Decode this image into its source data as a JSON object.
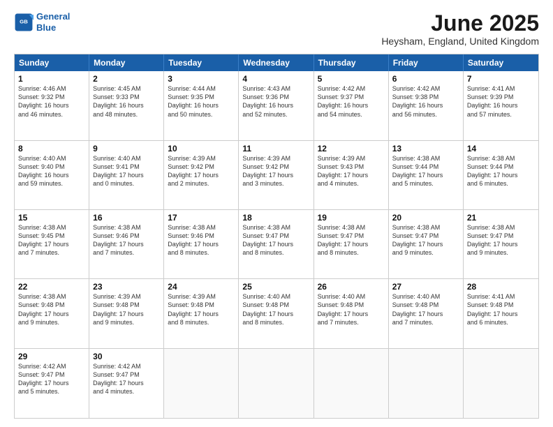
{
  "header": {
    "logo_line1": "General",
    "logo_line2": "Blue",
    "month_title": "June 2025",
    "location": "Heysham, England, United Kingdom"
  },
  "weekdays": [
    "Sunday",
    "Monday",
    "Tuesday",
    "Wednesday",
    "Thursday",
    "Friday",
    "Saturday"
  ],
  "rows": [
    [
      {
        "day": "1",
        "text": "Sunrise: 4:46 AM\nSunset: 9:32 PM\nDaylight: 16 hours\nand 46 minutes."
      },
      {
        "day": "2",
        "text": "Sunrise: 4:45 AM\nSunset: 9:33 PM\nDaylight: 16 hours\nand 48 minutes."
      },
      {
        "day": "3",
        "text": "Sunrise: 4:44 AM\nSunset: 9:35 PM\nDaylight: 16 hours\nand 50 minutes."
      },
      {
        "day": "4",
        "text": "Sunrise: 4:43 AM\nSunset: 9:36 PM\nDaylight: 16 hours\nand 52 minutes."
      },
      {
        "day": "5",
        "text": "Sunrise: 4:42 AM\nSunset: 9:37 PM\nDaylight: 16 hours\nand 54 minutes."
      },
      {
        "day": "6",
        "text": "Sunrise: 4:42 AM\nSunset: 9:38 PM\nDaylight: 16 hours\nand 56 minutes."
      },
      {
        "day": "7",
        "text": "Sunrise: 4:41 AM\nSunset: 9:39 PM\nDaylight: 16 hours\nand 57 minutes."
      }
    ],
    [
      {
        "day": "8",
        "text": "Sunrise: 4:40 AM\nSunset: 9:40 PM\nDaylight: 16 hours\nand 59 minutes."
      },
      {
        "day": "9",
        "text": "Sunrise: 4:40 AM\nSunset: 9:41 PM\nDaylight: 17 hours\nand 0 minutes."
      },
      {
        "day": "10",
        "text": "Sunrise: 4:39 AM\nSunset: 9:42 PM\nDaylight: 17 hours\nand 2 minutes."
      },
      {
        "day": "11",
        "text": "Sunrise: 4:39 AM\nSunset: 9:42 PM\nDaylight: 17 hours\nand 3 minutes."
      },
      {
        "day": "12",
        "text": "Sunrise: 4:39 AM\nSunset: 9:43 PM\nDaylight: 17 hours\nand 4 minutes."
      },
      {
        "day": "13",
        "text": "Sunrise: 4:38 AM\nSunset: 9:44 PM\nDaylight: 17 hours\nand 5 minutes."
      },
      {
        "day": "14",
        "text": "Sunrise: 4:38 AM\nSunset: 9:44 PM\nDaylight: 17 hours\nand 6 minutes."
      }
    ],
    [
      {
        "day": "15",
        "text": "Sunrise: 4:38 AM\nSunset: 9:45 PM\nDaylight: 17 hours\nand 7 minutes."
      },
      {
        "day": "16",
        "text": "Sunrise: 4:38 AM\nSunset: 9:46 PM\nDaylight: 17 hours\nand 7 minutes."
      },
      {
        "day": "17",
        "text": "Sunrise: 4:38 AM\nSunset: 9:46 PM\nDaylight: 17 hours\nand 8 minutes."
      },
      {
        "day": "18",
        "text": "Sunrise: 4:38 AM\nSunset: 9:47 PM\nDaylight: 17 hours\nand 8 minutes."
      },
      {
        "day": "19",
        "text": "Sunrise: 4:38 AM\nSunset: 9:47 PM\nDaylight: 17 hours\nand 8 minutes."
      },
      {
        "day": "20",
        "text": "Sunrise: 4:38 AM\nSunset: 9:47 PM\nDaylight: 17 hours\nand 9 minutes."
      },
      {
        "day": "21",
        "text": "Sunrise: 4:38 AM\nSunset: 9:47 PM\nDaylight: 17 hours\nand 9 minutes."
      }
    ],
    [
      {
        "day": "22",
        "text": "Sunrise: 4:38 AM\nSunset: 9:48 PM\nDaylight: 17 hours\nand 9 minutes."
      },
      {
        "day": "23",
        "text": "Sunrise: 4:39 AM\nSunset: 9:48 PM\nDaylight: 17 hours\nand 9 minutes."
      },
      {
        "day": "24",
        "text": "Sunrise: 4:39 AM\nSunset: 9:48 PM\nDaylight: 17 hours\nand 8 minutes."
      },
      {
        "day": "25",
        "text": "Sunrise: 4:40 AM\nSunset: 9:48 PM\nDaylight: 17 hours\nand 8 minutes."
      },
      {
        "day": "26",
        "text": "Sunrise: 4:40 AM\nSunset: 9:48 PM\nDaylight: 17 hours\nand 7 minutes."
      },
      {
        "day": "27",
        "text": "Sunrise: 4:40 AM\nSunset: 9:48 PM\nDaylight: 17 hours\nand 7 minutes."
      },
      {
        "day": "28",
        "text": "Sunrise: 4:41 AM\nSunset: 9:48 PM\nDaylight: 17 hours\nand 6 minutes."
      }
    ],
    [
      {
        "day": "29",
        "text": "Sunrise: 4:42 AM\nSunset: 9:47 PM\nDaylight: 17 hours\nand 5 minutes."
      },
      {
        "day": "30",
        "text": "Sunrise: 4:42 AM\nSunset: 9:47 PM\nDaylight: 17 hours\nand 4 minutes."
      },
      {
        "day": "",
        "text": ""
      },
      {
        "day": "",
        "text": ""
      },
      {
        "day": "",
        "text": ""
      },
      {
        "day": "",
        "text": ""
      },
      {
        "day": "",
        "text": ""
      }
    ]
  ]
}
